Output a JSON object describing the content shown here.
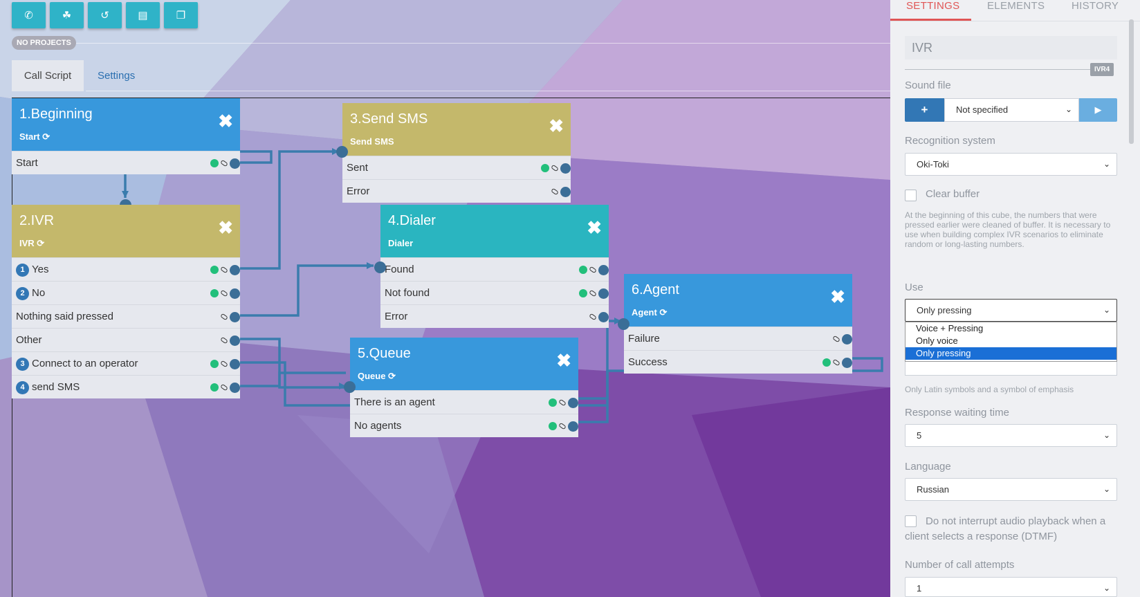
{
  "toolbar": {
    "buttons": [
      {
        "icon": "phone-icon",
        "glyph": "✆"
      },
      {
        "icon": "network-icon",
        "glyph": "☘"
      },
      {
        "icon": "history-icon",
        "glyph": "↺"
      },
      {
        "icon": "document-icon",
        "glyph": "▤"
      },
      {
        "icon": "copy-icon",
        "glyph": "❐"
      }
    ]
  },
  "project_badge": "NO PROJECTS",
  "tabs": {
    "call_script": "Call Script",
    "settings": "Settings"
  },
  "cubes": {
    "c1": {
      "title": "1.Beginning",
      "sub": "Start",
      "rows": [
        "Start"
      ]
    },
    "c2": {
      "title": "2.IVR",
      "sub": "IVR",
      "rows": [
        {
          "n": "1",
          "label": "Yes"
        },
        {
          "n": "2",
          "label": "No"
        },
        {
          "n": "",
          "label": "Nothing said pressed"
        },
        {
          "n": "",
          "label": "Other"
        },
        {
          "n": "3",
          "label": "Connect to an operator"
        },
        {
          "n": "4",
          "label": "send SMS"
        }
      ]
    },
    "c3": {
      "title": "3.Send SMS",
      "sub": "Send SMS",
      "rows": [
        "Sent",
        "Error"
      ]
    },
    "c4": {
      "title": "4.Dialer",
      "sub": "Dialer",
      "rows": [
        "Found",
        "Not found",
        "Error"
      ]
    },
    "c5": {
      "title": "5.Queue",
      "sub": "Queue",
      "rows": [
        "There is an agent",
        "No agents"
      ]
    },
    "c6": {
      "title": "6.Agent",
      "sub": "Agent",
      "rows": [
        "Failure",
        "Success"
      ]
    }
  },
  "colors": {
    "blue": "#3898dc",
    "olive": "#c4b86b",
    "teal": "#2ab5c0",
    "accent": "#e05555"
  },
  "panel": {
    "tabs": [
      "SETTINGS",
      "ELEMENTS",
      "HISTORY"
    ],
    "name_value": "IVR",
    "name_badge": "IVR4",
    "sound_label": "Sound file",
    "sound_value": "Not specified",
    "add": "+",
    "play": "▶",
    "recog_label": "Recognition system",
    "recog_value": "Oki-Toki",
    "clear_label": "Clear buffer",
    "clear_note": "At the beginning of this cube, the numbers that were pressed earlier were cleaned of buffer. It is necessary to use when building complex IVR scenarios to eliminate random or long-lasting numbers.",
    "use_label": "Use",
    "use_value": "Only pressing",
    "use_options": [
      "Voice + Pressing",
      "Only voice",
      "Only pressing"
    ],
    "latin_note": "Only Latin symbols and a symbol of emphasis",
    "wait_label": "Response waiting time",
    "wait_value": "5",
    "lang_label": "Language",
    "lang_value": "Russian",
    "dtmf_label": "Do not interrupt audio playback when a client selects a response (DTMF)",
    "attempts_label": "Number of call attempts",
    "attempts_value": "1"
  }
}
